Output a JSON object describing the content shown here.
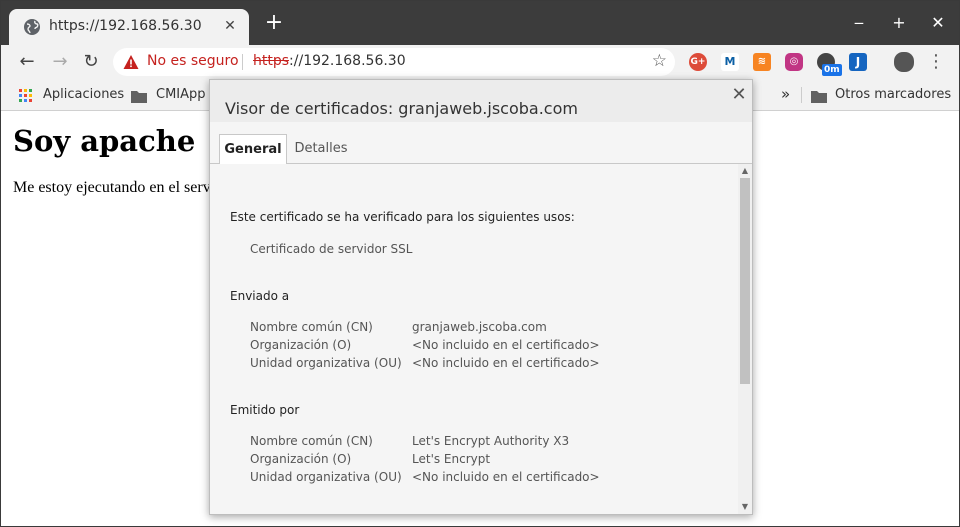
{
  "browser": {
    "tab_title": "https://192.168.56.30",
    "tab_close": "✕",
    "new_tab": "+",
    "window_controls": {
      "minimize": "‒",
      "maximize": "+",
      "close": "✕"
    }
  },
  "toolbar": {
    "back": "←",
    "forward": "→",
    "reload": "↻",
    "security_label": "No es seguro",
    "url_scheme": "https",
    "url_rest": "://192.168.56.30",
    "star": "☆",
    "extensions": [
      {
        "name": "google-plus-icon",
        "text": "G+",
        "color": "#dd4b39"
      },
      {
        "name": "movistar-icon",
        "text": "M",
        "color": "#ffffff"
      },
      {
        "name": "rss-icon",
        "text": "≋",
        "color": "#f78422"
      },
      {
        "name": "instagram-icon",
        "text": "◎",
        "color": "#c13584"
      },
      {
        "name": "timer-icon",
        "text": "0m",
        "color": "#444444"
      },
      {
        "name": "j-icon",
        "text": "J",
        "color": "#1565c0"
      }
    ],
    "menu": "⋮",
    "accent_colors": {
      "warning": "#c5221f"
    }
  },
  "bookmarks": {
    "apps": "Aplicaciones",
    "cmiapp": "CMIApp",
    "more": "»",
    "other": "Otros marcadores"
  },
  "page": {
    "heading": "Soy apache",
    "paragraph": "Me estoy ejecutando en el serv"
  },
  "dialog": {
    "title": "Visor de certificados: granjaweb.jscoba.com",
    "close": "✕",
    "tabs": [
      "General",
      "Detalles"
    ],
    "uses_title": "Este certificado se ha verificado para los siguientes usos:",
    "uses": [
      "Certificado de servidor SSL"
    ],
    "issued_to_title": "Enviado a",
    "issued_to": [
      {
        "label": "Nombre común (CN)",
        "value": "granjaweb.jscoba.com"
      },
      {
        "label": "Organización (O)",
        "value": "<No incluido en el certificado>"
      },
      {
        "label": "Unidad organizativa (OU)",
        "value": "<No incluido en el certificado>"
      }
    ],
    "issued_by_title": "Emitido por",
    "issued_by": [
      {
        "label": "Nombre común (CN)",
        "value": "Let's Encrypt Authority X3"
      },
      {
        "label": "Organización (O)",
        "value": "Let's Encrypt"
      },
      {
        "label": "Unidad organizativa (OU)",
        "value": "<No incluido en el certificado>"
      }
    ]
  }
}
